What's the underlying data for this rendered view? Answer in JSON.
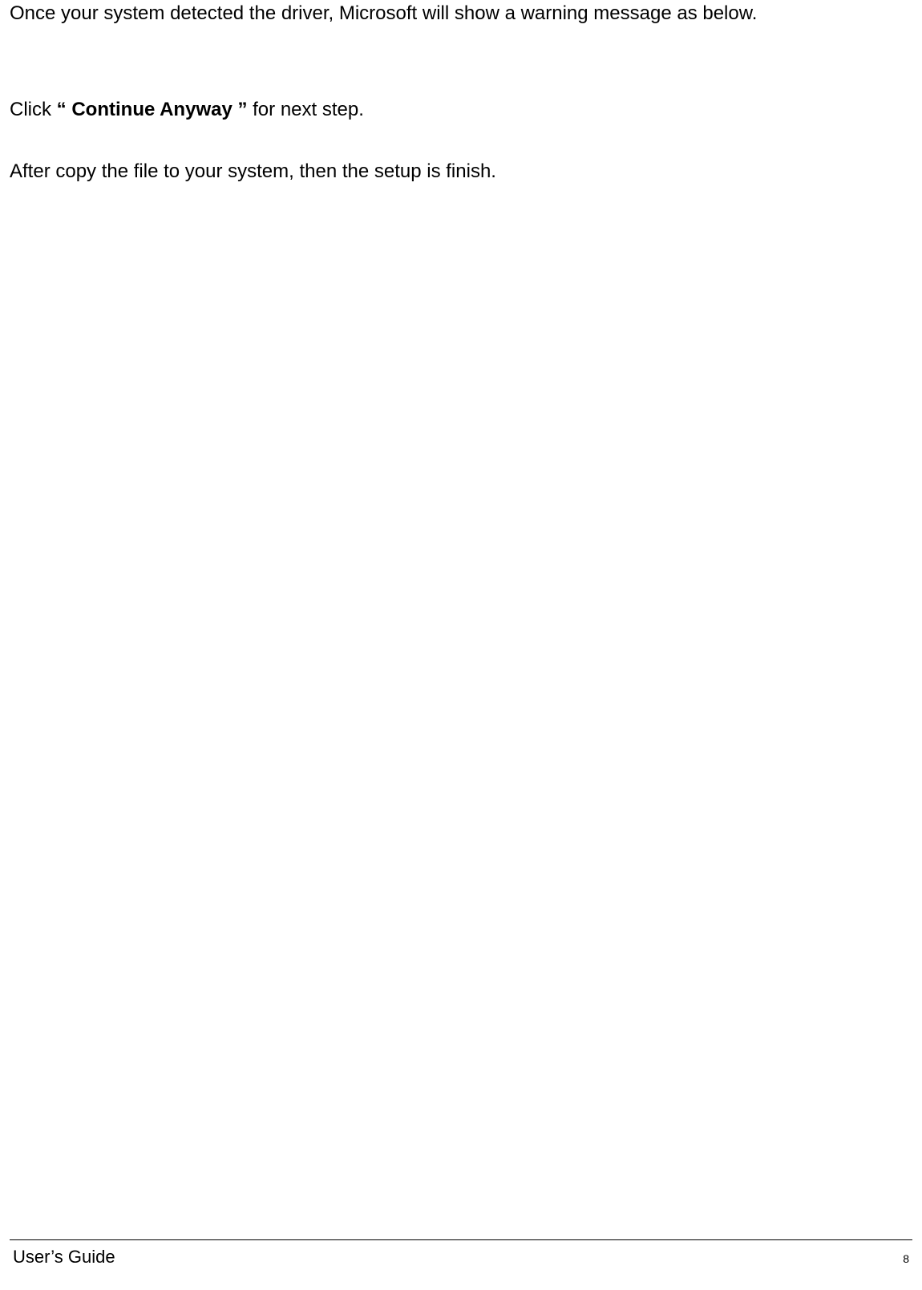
{
  "content": {
    "para1": "Once your system detected the driver, Microsoft will show a warning message as below.",
    "para2_prefix": "Click ",
    "para2_bold": "“ Continue Anyway ”",
    "para2_suffix": " for next step.",
    "para3": "After copy the file to your system, then the setup is finish."
  },
  "footer": {
    "title": "User’s Guide",
    "page": "8"
  }
}
